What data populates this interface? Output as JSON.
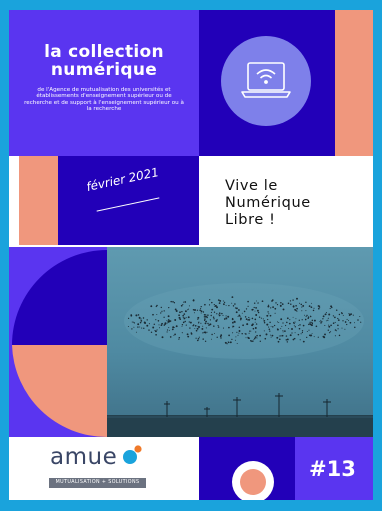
{
  "cover": {
    "collection_title_line1": "la collection",
    "collection_title_line2": "numérique",
    "collection_subtitle": "de l'Agence de mutualisation des universités et établissements d'enseignement supérieur ou de recherche et de support à l'enseignement supérieur ou à la recherche",
    "date": "février 2021",
    "slogan_line1": "Vive le",
    "slogan_line2": "Numérique",
    "slogan_line3": "Libre !",
    "issue_number": "#13"
  },
  "brand": {
    "logo_word": "amue",
    "logo_tagline": "MUTUALISATION + SOLUTIONS"
  },
  "icons": {
    "laptop": "laptop-wifi-icon",
    "logo_mark": "amue-logo-mark-icon"
  },
  "colors": {
    "frame": "#1aa3dc",
    "purple": "#5a35f0",
    "navy": "#2200b8",
    "salmon": "#f0977d",
    "lavender": "#7e80ea"
  }
}
